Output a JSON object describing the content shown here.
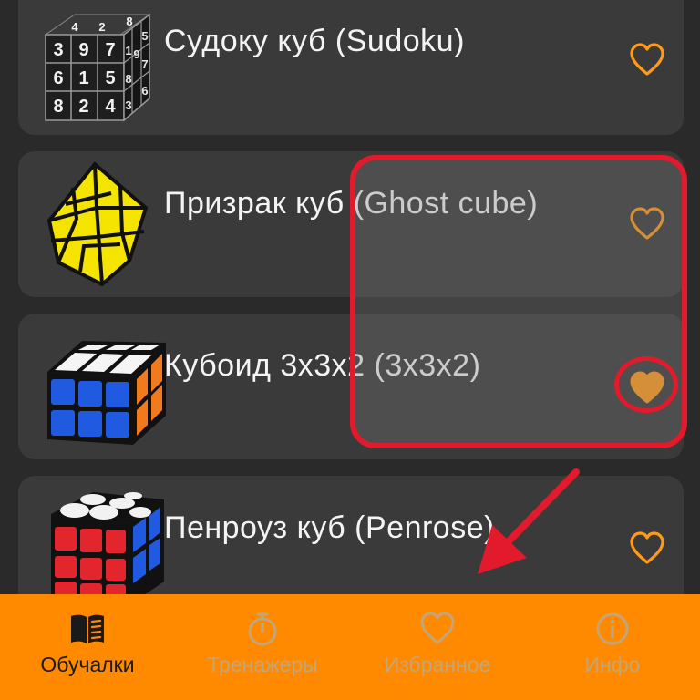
{
  "items": [
    {
      "title": "Судоку куб (Sudoku)",
      "favorite": false,
      "thumb_icon": "sudoku-cube-icon"
    },
    {
      "title": "Призрак куб (Ghost cube)",
      "favorite": false,
      "thumb_icon": "ghost-cube-icon"
    },
    {
      "title": "Кубоид 3x3x2 (3x3x2)",
      "favorite": true,
      "thumb_icon": "cuboid-3x3x2-icon"
    },
    {
      "title": "Пенроуз куб (Penrose)",
      "favorite": false,
      "thumb_icon": "penrose-cube-icon"
    }
  ],
  "sudoku_digits": {
    "front": [
      "3",
      "9",
      "7",
      "6",
      "1",
      "5",
      "8",
      "2",
      "4"
    ],
    "top": [
      "4",
      "2",
      "8"
    ],
    "side": [
      "1",
      "5",
      "9",
      "8",
      "7",
      "3",
      "6"
    ]
  },
  "tabs": [
    {
      "label": "Обучалки",
      "icon": "book-icon",
      "active": true
    },
    {
      "label": "Тренажеры",
      "icon": "stopwatch-icon",
      "active": false
    },
    {
      "label": "Избранное",
      "icon": "heart-icon",
      "active": false
    },
    {
      "label": "Инфо",
      "icon": "info-icon",
      "active": false
    }
  ],
  "colors": {
    "accent": "#ff8a00",
    "background": "#2a2a2a",
    "card": "#3a3a3a",
    "annotation": "#e3192c",
    "heart": "#ff9a1a"
  }
}
